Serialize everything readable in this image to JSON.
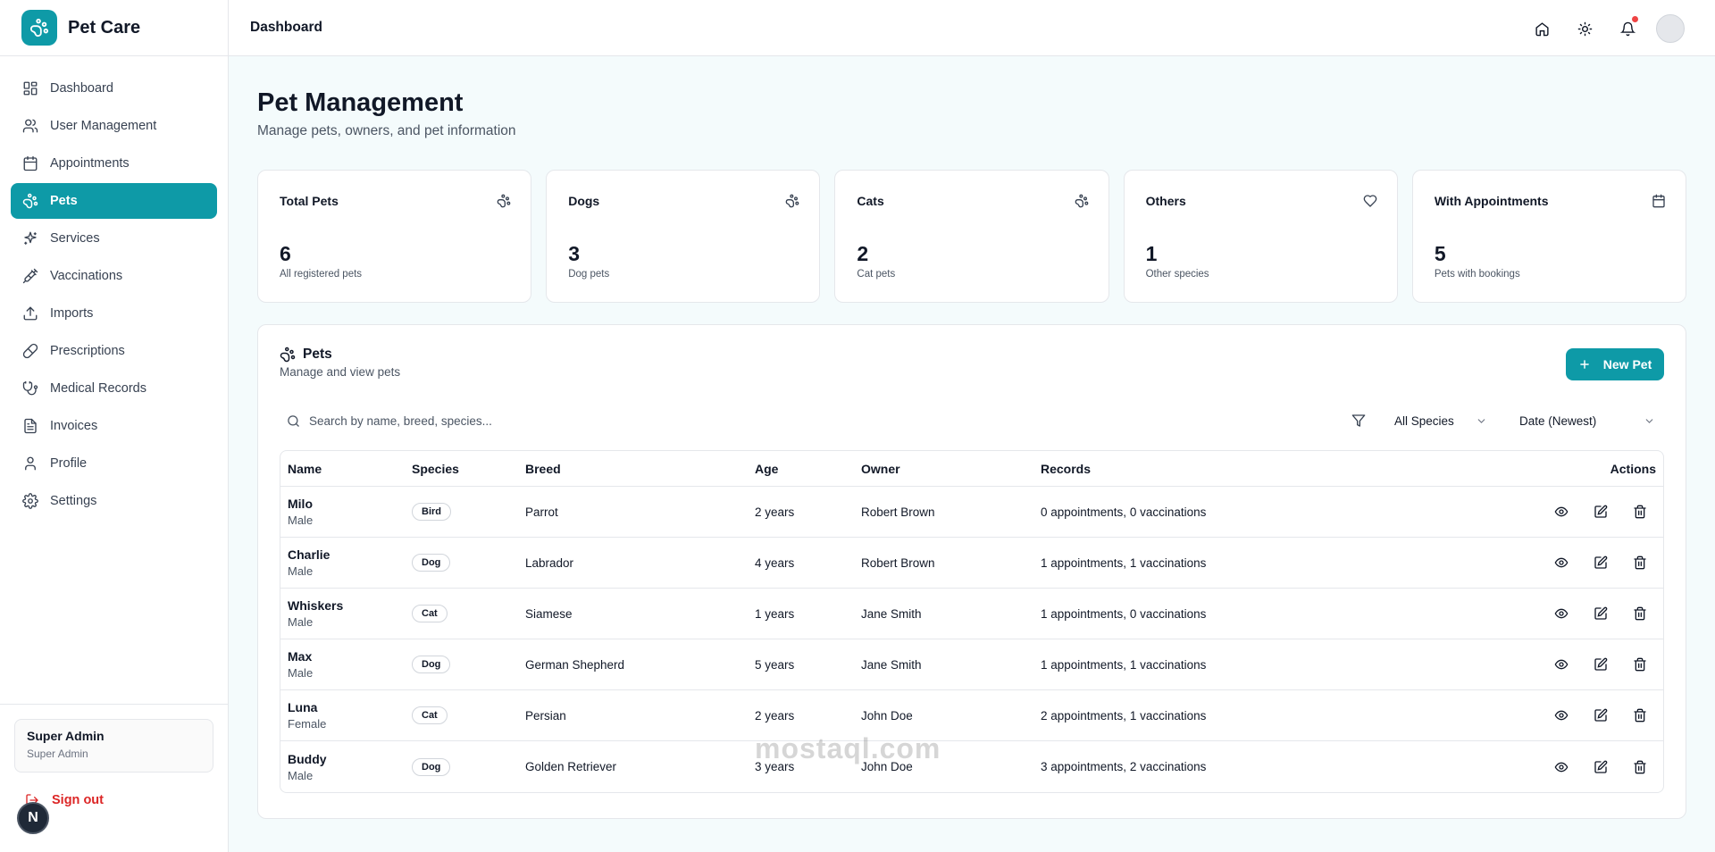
{
  "brand": {
    "name": "Pet Care"
  },
  "header": {
    "title": "Dashboard"
  },
  "sidebar": {
    "items": [
      {
        "label": "Dashboard",
        "icon": "dashboard-icon"
      },
      {
        "label": "User Management",
        "icon": "users-icon"
      },
      {
        "label": "Appointments",
        "icon": "calendar-icon"
      },
      {
        "label": "Pets",
        "icon": "paw-icon",
        "active": true
      },
      {
        "label": "Services",
        "icon": "sparkles-icon"
      },
      {
        "label": "Vaccinations",
        "icon": "syringe-icon"
      },
      {
        "label": "Imports",
        "icon": "upload-icon"
      },
      {
        "label": "Prescriptions",
        "icon": "pill-icon"
      },
      {
        "label": "Medical Records",
        "icon": "stethoscope-icon"
      },
      {
        "label": "Invoices",
        "icon": "file-icon"
      },
      {
        "label": "Profile",
        "icon": "user-icon"
      },
      {
        "label": "Settings",
        "icon": "gear-icon"
      }
    ],
    "user": {
      "name": "Super Admin",
      "role": "Super Admin"
    },
    "signout_label": "Sign out",
    "badge_letter": "N"
  },
  "page": {
    "title": "Pet Management",
    "subtitle": "Manage pets, owners, and pet information"
  },
  "stats": [
    {
      "title": "Total Pets",
      "value": "6",
      "sub": "All registered pets",
      "icon": "paw-icon"
    },
    {
      "title": "Dogs",
      "value": "3",
      "sub": "Dog pets",
      "icon": "paw-icon"
    },
    {
      "title": "Cats",
      "value": "2",
      "sub": "Cat pets",
      "icon": "paw-icon"
    },
    {
      "title": "Others",
      "value": "1",
      "sub": "Other species",
      "icon": "heart-icon"
    },
    {
      "title": "With Appointments",
      "value": "5",
      "sub": "Pets with bookings",
      "icon": "calendar-icon"
    }
  ],
  "panel": {
    "title": "Pets",
    "subtitle": "Manage and view pets",
    "new_button": "New Pet",
    "search_placeholder": "Search by name, breed, species...",
    "species_filter": "All Species",
    "sort": "Date (Newest)"
  },
  "table": {
    "headers": {
      "name": "Name",
      "species": "Species",
      "breed": "Breed",
      "age": "Age",
      "owner": "Owner",
      "records": "Records",
      "actions": "Actions"
    },
    "rows": [
      {
        "name": "Milo",
        "gender": "Male",
        "species": "Bird",
        "breed": "Parrot",
        "age": "2 years",
        "owner": "Robert Brown",
        "records": "0 appointments, 0 vaccinations"
      },
      {
        "name": "Charlie",
        "gender": "Male",
        "species": "Dog",
        "breed": "Labrador",
        "age": "4 years",
        "owner": "Robert Brown",
        "records": "1 appointments, 1 vaccinations"
      },
      {
        "name": "Whiskers",
        "gender": "Male",
        "species": "Cat",
        "breed": "Siamese",
        "age": "1 years",
        "owner": "Jane Smith",
        "records": "1 appointments, 0 vaccinations"
      },
      {
        "name": "Max",
        "gender": "Male",
        "species": "Dog",
        "breed": "German Shepherd",
        "age": "5 years",
        "owner": "Jane Smith",
        "records": "1 appointments, 1 vaccinations"
      },
      {
        "name": "Luna",
        "gender": "Female",
        "species": "Cat",
        "breed": "Persian",
        "age": "2 years",
        "owner": "John Doe",
        "records": "2 appointments, 1 vaccinations"
      },
      {
        "name": "Buddy",
        "gender": "Male",
        "species": "Dog",
        "breed": "Golden Retriever",
        "age": "3 years",
        "owner": "John Doe",
        "records": "3 appointments, 2 vaccinations"
      }
    ]
  },
  "watermark": "mostaql.com",
  "colors": {
    "accent": "#0e9aa7",
    "danger": "#dc2626",
    "notification": "#ef4444"
  }
}
